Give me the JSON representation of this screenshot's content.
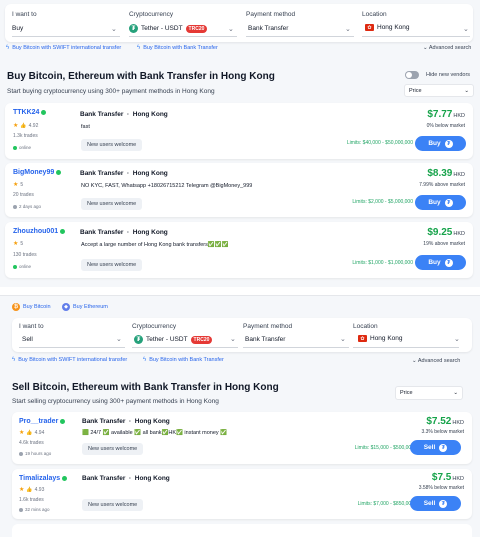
{
  "buy_panel": {
    "filters": {
      "want_label": "I want to",
      "want_value": "Buy",
      "crypto_label": "Cryptocurrency",
      "crypto_value": "Tether - USDT",
      "crypto_network": "TRC20",
      "payment_label": "Payment method",
      "payment_value": "Bank Transfer",
      "location_label": "Location",
      "location_value": "Hong Kong"
    },
    "quick_links": [
      "Buy Bitcoin with SWIFT international transfer",
      "Buy Bitcoin with Bank Transfer"
    ],
    "advanced_search": "Advanced search",
    "title": "Buy Bitcoin, Ethereum with Bank Transfer in Hong Kong",
    "subtitle": "Start buying cryptocurrency using 300+ payment methods in Hong Kong",
    "hide_vendors_label": "Hide new vendors",
    "sort_value": "Price",
    "offers": [
      {
        "vendor": "TTKK24",
        "rating": "4.92",
        "trades": "1.3k trades",
        "status": "online",
        "status_color": "#22c55e",
        "method": "Bank Transfer",
        "location": "Hong Kong",
        "description": "fast",
        "tag": "New users welcome",
        "limits": "Limits: $40,000 - $50,000,000",
        "price": "$7.77",
        "currency": "HKD",
        "margin": "0% below market",
        "action": "Buy"
      },
      {
        "vendor": "BigMoney99",
        "rating": "5",
        "trades": "20 trades",
        "status": "2 days ago",
        "status_color": "#9ca3af",
        "method": "Bank Transfer",
        "location": "Hong Kong",
        "description": "NO KYC, FAST, Whatsapp +18026715212 Telegram @BigMoney_999",
        "tag": "New users welcome",
        "limits": "Limits: $2,000 - $5,000,000",
        "price": "$8.39",
        "currency": "HKD",
        "margin": "7.99% above market",
        "action": "Buy"
      },
      {
        "vendor": "Zhouzhou001",
        "rating": "5",
        "trades": "130 trades",
        "status": "online",
        "status_color": "#22c55e",
        "method": "Bank Transfer",
        "location": "Hong Kong",
        "description": "Accept a large number of Hong Kong bank transfers✅✅✅",
        "tag": "New users welcome",
        "limits": "Limits: $1,000 - $1,000,000",
        "price": "$9.25",
        "currency": "HKD",
        "margin": "19% above market",
        "action": "Buy"
      }
    ]
  },
  "sell_panel": {
    "coin_tabs": [
      "Buy Bitcoin",
      "Buy Ethereum"
    ],
    "filters": {
      "want_label": "I want to",
      "want_value": "Sell",
      "crypto_label": "Cryptocurrency",
      "crypto_value": "Tether - USDT",
      "crypto_network": "TRC20",
      "payment_label": "Payment method",
      "payment_value": "Bank Transfer",
      "location_label": "Location",
      "location_value": "Hong Kong"
    },
    "quick_links": [
      "Buy Bitcoin with SWIFT international transfer",
      "Buy Bitcoin with Bank Transfer"
    ],
    "advanced_search": "Advanced search",
    "title": "Sell Bitcoin, Ethereum with Bank Transfer in Hong Kong",
    "subtitle": "Start selling cryptocurrency using 300+ payment methods in Hong Kong",
    "sort_value": "Price",
    "offers": [
      {
        "vendor": "Pro__trader",
        "rating": "4.94",
        "trades": "4.6k trades",
        "status": "19 hours ago",
        "method": "Bank Transfer",
        "location": "Hong Kong",
        "description": "🟩 24/7 ✅ available ✅ all bank✅HK✅ instant money ✅",
        "tag": "New users welcome",
        "limits": "Limits: $15,000 - $500,000",
        "price": "$7.52",
        "currency": "HKD",
        "margin": "3.3% below market",
        "action": "Sell"
      },
      {
        "vendor": "Timalizalays",
        "rating": "4.93",
        "trades": "1.6k trades",
        "status": "32 mins ago",
        "method": "Bank Transfer",
        "location": "Hong Kong",
        "description": "",
        "tag": "New users welcome",
        "limits": "Limits: $7,000 - $850,000",
        "price": "$7.5",
        "currency": "HKD",
        "margin": "3.58% below market",
        "action": "Sell"
      }
    ]
  }
}
